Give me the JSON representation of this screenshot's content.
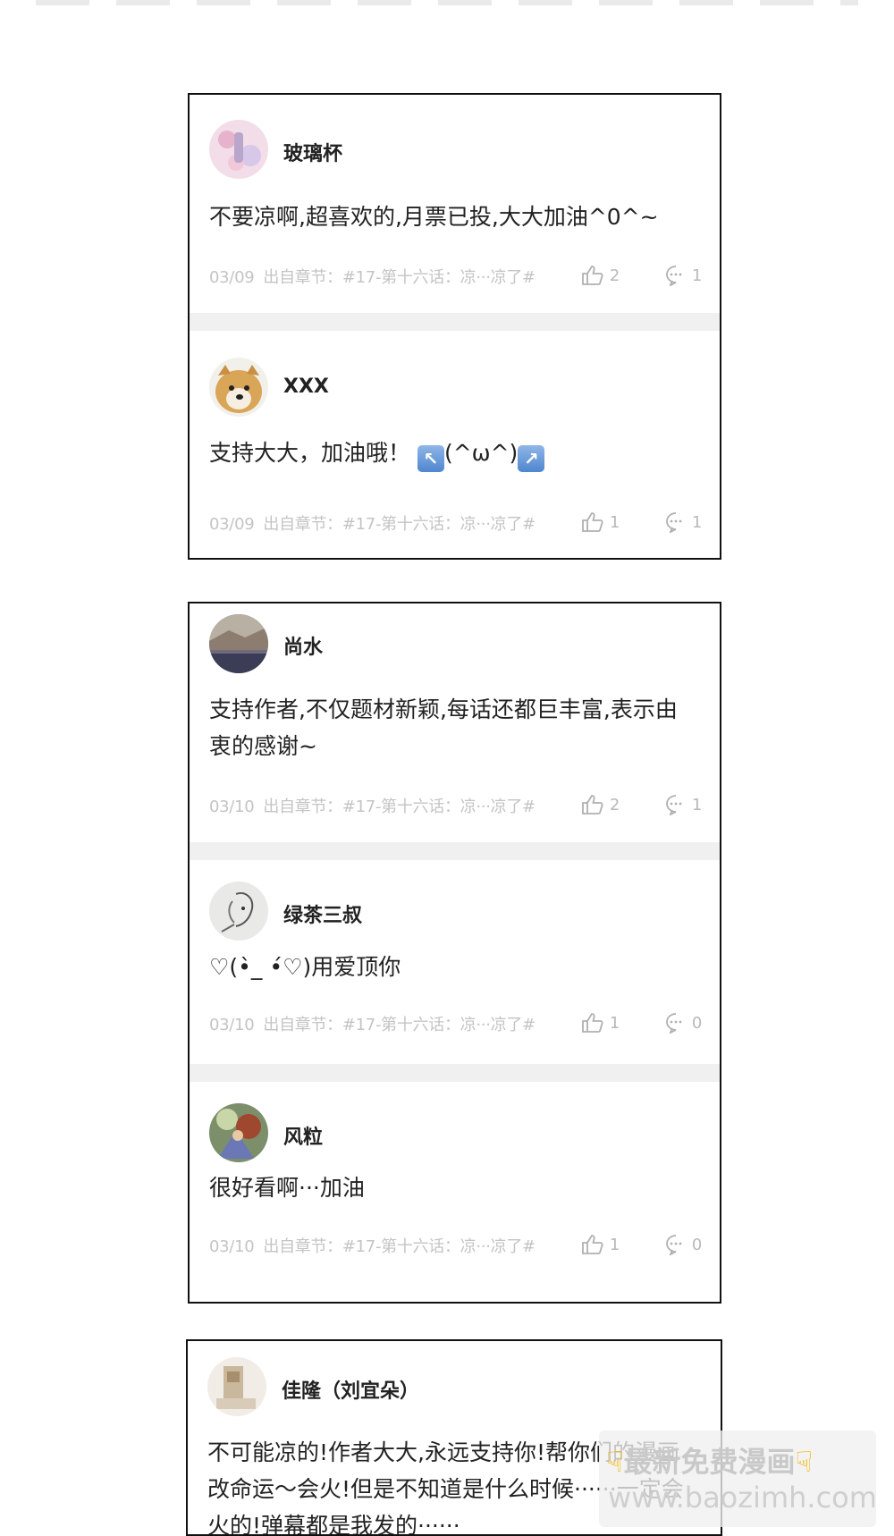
{
  "comments_group_1": [
    {
      "username": "玻璃杯",
      "text": "不要凉啊,超喜欢的,月票已投,大大加油^0^~",
      "date": "03/09",
      "source": "出自章节：#17-第十六话：凉···凉了#",
      "likes": "2",
      "replies": "1"
    },
    {
      "username": "XXX",
      "text_prefix": "支持大大，加油哦！",
      "emoji_left": "↖",
      "text_middle": "(^ω^)",
      "emoji_right": "↗",
      "date": "03/09",
      "source": "出自章节：#17-第十六话：凉···凉了#",
      "likes": "1",
      "replies": "1"
    }
  ],
  "comments_group_2": [
    {
      "username": "尚水",
      "text": "支持作者,不仅题材新颖,每话还都巨丰富,表示由衷的感谢~",
      "date": "03/10",
      "source": "出自章节：#17-第十六话：凉···凉了#",
      "likes": "2",
      "replies": "1"
    },
    {
      "username": "绿茶三叔",
      "text": "♡(•̀_ •́♡)用爱顶你",
      "date": "03/10",
      "source": "出自章节：#17-第十六话：凉···凉了#",
      "likes": "1",
      "replies": "0"
    },
    {
      "username": "风粒",
      "text": "很好看啊···加油",
      "date": "03/10",
      "source": "出自章节：#17-第十六话：凉···凉了#",
      "likes": "1",
      "replies": "0"
    }
  ],
  "comments_group_3": [
    {
      "username": "佳隆（刘宜朵）",
      "text": "不可能凉的!作者大大,永远支持你!帮你们的漫画改命运～会火!但是不知道是什么时候······一定会火的!弹幕都是我发的······"
    }
  ],
  "watermark": {
    "title": "最新免费漫画",
    "url": "www.baozimh.com",
    "hand_icon": "pointing-down-hand"
  },
  "colors": {
    "panel_border": "#111111",
    "meta_text": "#c4c4c4",
    "divider": "#f0f0f0"
  }
}
